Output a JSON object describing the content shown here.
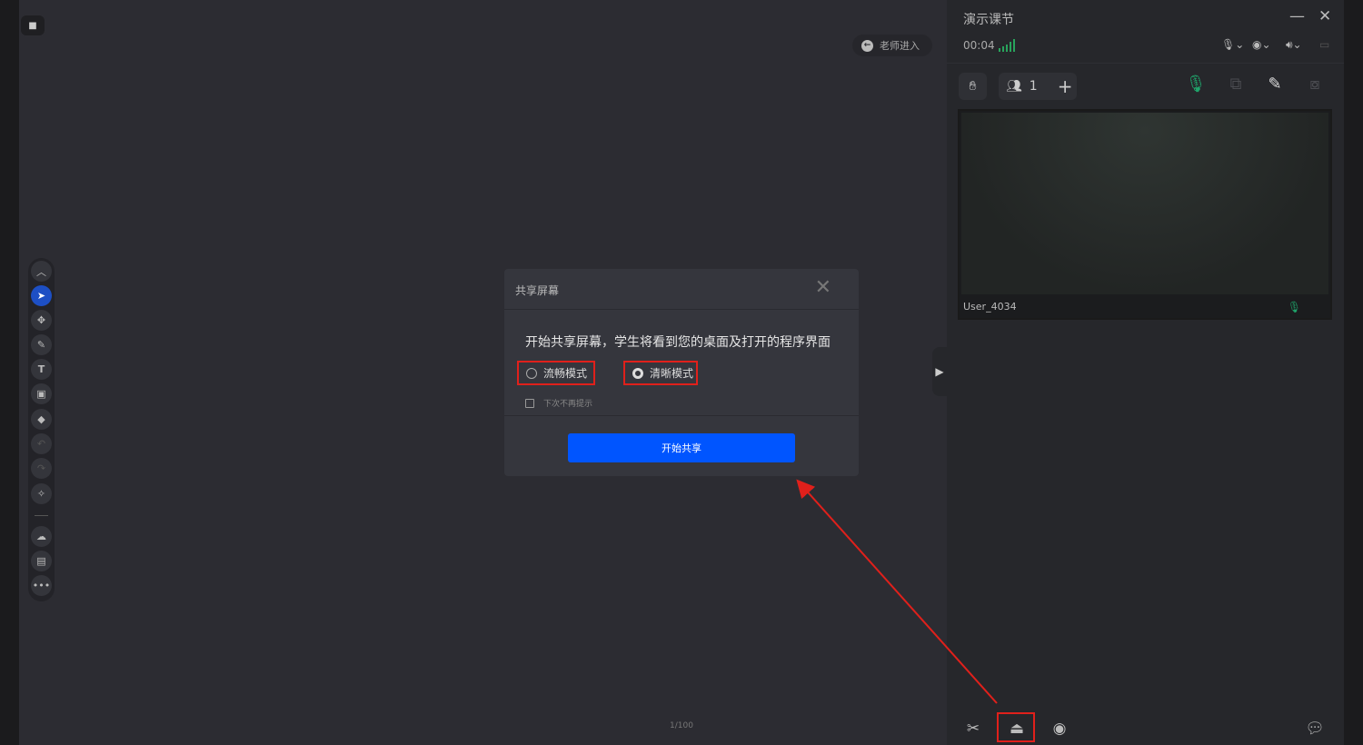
{
  "canvas": {
    "enter_label": "老师进入",
    "page_indicator": "1/100"
  },
  "toolbar": {
    "icons": [
      "chevron-up",
      "pointer",
      "move",
      "pen",
      "text",
      "image",
      "eraser",
      "undo",
      "redo",
      "magic-wand",
      "cloud",
      "toolbox",
      "more"
    ]
  },
  "dialog": {
    "title": "共享屏幕",
    "message": "开始共享屏幕，学生将看到您的桌面及打开的程序界面",
    "options": [
      {
        "label": "流畅模式",
        "selected": false
      },
      {
        "label": "清晰模式",
        "selected": true
      }
    ],
    "dont_show_again": "下次不再提示",
    "start_button": "开始共享"
  },
  "panel": {
    "title": "演示课节",
    "timer": "00:04",
    "participant_count": "1",
    "video": {
      "user": "User_4034"
    }
  },
  "colors": {
    "accent": "#0055ff",
    "highlight": "#e0201b",
    "signal": "#28a35c",
    "mic_active": "#1fa36a"
  }
}
